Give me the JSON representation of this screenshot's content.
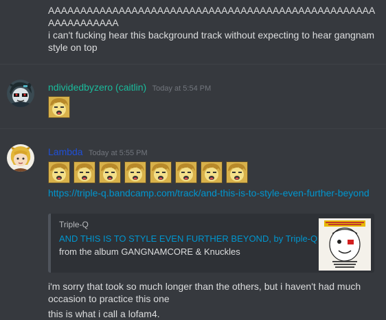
{
  "top_message": {
    "line1": "AAAAAAAAAAAAAAAAAAAAAAAAAAAAAAAAAAAAAAAAAAAAAAAAAAAAAAAAAAAAAA",
    "line2": "i can't fucking hear this background track without expecting to hear gangnam style on top"
  },
  "group1": {
    "username": "ndividedbyzero (caitlin)",
    "username_color": "#1abc9c",
    "timestamp": "Today at 5:54 PM",
    "emoji_count": 1
  },
  "group2": {
    "username": "Lambda",
    "username_color": "#1f4fd6",
    "timestamp": "Today at 5:55 PM",
    "emoji_count": 8,
    "link_text": "https://triple-q.bandcamp.com/track/and-this-is-to-style-even-further-beyond",
    "embed": {
      "provider": "Triple-Q",
      "title": "AND THIS IS TO STYLE EVEN FURTHER BEYOND, by Triple-Q",
      "description": "from the album GANGNAMCORE & Knuckles",
      "accent_color": "#4f545c"
    },
    "message1": "i'm sorry that took so much longer than the others, but i haven't had much occasion to practice this one",
    "message2": "this is what i call a lofam4."
  },
  "colors": {
    "background": "#36393e",
    "text": "#dcddde",
    "link": "#0096cf",
    "timestamp": "#72767d"
  },
  "icons": {
    "emoji": "yellow-cartoon-face-emoji",
    "avatar1": "character-avatar",
    "avatar2": "character-avatar"
  }
}
